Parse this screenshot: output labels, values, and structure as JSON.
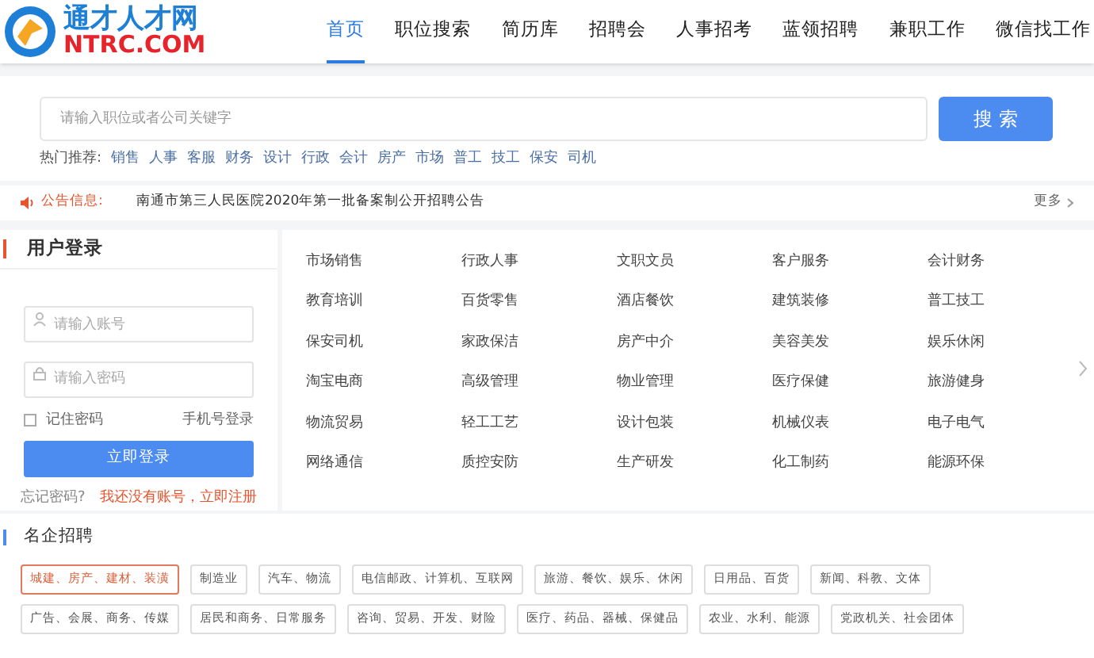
{
  "logo": {
    "name": "通才人才网",
    "domain": "NTRC.COM"
  },
  "nav": [
    {
      "label": "首页",
      "selected": true
    },
    {
      "label": "职位搜索",
      "selected": false
    },
    {
      "label": "简历库",
      "selected": false
    },
    {
      "label": "招聘会",
      "selected": false
    },
    {
      "label": "人事招考",
      "selected": false
    },
    {
      "label": "蓝领招聘",
      "selected": false
    },
    {
      "label": "兼职工作",
      "selected": false
    },
    {
      "label": "微信找工作",
      "selected": false
    }
  ],
  "search": {
    "placeholder": "请输入职位或者公司关键字",
    "button": "搜 索"
  },
  "hot": {
    "label": "热门推荐:",
    "items": [
      "销售",
      "人事",
      "客服",
      "财务",
      "设计",
      "行政",
      "会计",
      "房产",
      "市场",
      "普工",
      "技工",
      "保安",
      "司机"
    ]
  },
  "notice": {
    "label": "公告信息:",
    "text": "南通市第三人民医院2020年第一批备案制公开招聘公告",
    "more": "更多"
  },
  "login": {
    "title": "用户登录",
    "account_placeholder": "请输入账号",
    "password_placeholder": "请输入密码",
    "remember": {
      "label": "记住密码",
      "checked": false
    },
    "phone_login": "手机号登录",
    "button": "立即登录",
    "forgot": "忘记密码?",
    "register": "我还没有账号，立即注册"
  },
  "categories": [
    "市场销售",
    "行政人事",
    "文职文员",
    "客户服务",
    "会计财务",
    "教育培训",
    "百货零售",
    "酒店餐饮",
    "建筑装修",
    "普工技工",
    "保安司机",
    "家政保洁",
    "房产中介",
    "美容美发",
    "娱乐休闲",
    "淘宝电商",
    "高级管理",
    "物业管理",
    "医疗保健",
    "旅游健身",
    "物流贸易",
    "轻工工艺",
    "设计包装",
    "机械仪表",
    "电子电气",
    "网络通信",
    "质控安防",
    "生产研发",
    "化工制药",
    "能源环保"
  ],
  "companies": {
    "title": "名企招聘",
    "tags": [
      {
        "label": "城建、房产、建材、装潢",
        "selected": true
      },
      {
        "label": "制造业",
        "selected": false
      },
      {
        "label": "汽车、物流",
        "selected": false
      },
      {
        "label": "电信邮政、计算机、互联网",
        "selected": false
      },
      {
        "label": "旅游、餐饮、娱乐、休闲",
        "selected": false
      },
      {
        "label": "日用品、百货",
        "selected": false
      },
      {
        "label": "新闻、科教、文体",
        "selected": false
      },
      {
        "label": "广告、会展、商务、传媒",
        "selected": false
      },
      {
        "label": "居民和商务、日常服务",
        "selected": false
      },
      {
        "label": "咨询、贸易、开发、财险",
        "selected": false
      },
      {
        "label": "医疗、药品、器械、保健品",
        "selected": false
      },
      {
        "label": "农业、水利、能源",
        "selected": false
      },
      {
        "label": "党政机关、社会团体",
        "selected": false
      }
    ]
  }
}
